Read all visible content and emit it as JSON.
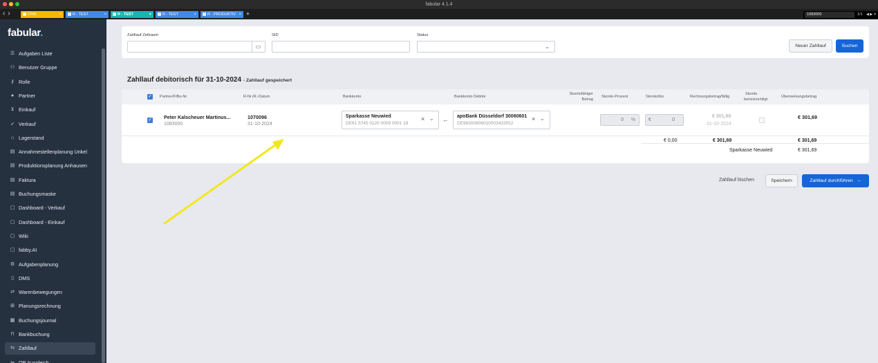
{
  "window": {
    "title": "fabular 4.1.4"
  },
  "tabs": [
    {
      "label": "CRM",
      "color": "#f5b800"
    },
    {
      "label": "R - TEST",
      "color": "#3e8be8"
    },
    {
      "label": "R - TEST",
      "color": "#17b6b0"
    },
    {
      "label": "R - TEST",
      "color": "#3e8be8"
    },
    {
      "label": "R - PRODUKTIV",
      "color": "#3e8be8"
    }
  ],
  "find": {
    "value": "1083000",
    "count": "1/1"
  },
  "sidebar": {
    "logo": "fabular",
    "items": [
      {
        "label": "Aufgaben Liste",
        "icon": "list-icon"
      },
      {
        "label": "Benutzer Gruppe",
        "icon": "group-icon"
      },
      {
        "label": "Rolle",
        "icon": "key-icon"
      },
      {
        "label": "Partner",
        "icon": "person-icon"
      },
      {
        "label": "Einkauf",
        "icon": "cart-icon"
      },
      {
        "label": "Verkauf",
        "icon": "rocket-icon"
      },
      {
        "label": "Lagerstand",
        "icon": "warehouse-icon"
      },
      {
        "label": "Annahmestellenplanung Unkel",
        "icon": "document-icon"
      },
      {
        "label": "Produktionsplanung Anhausen",
        "icon": "document-icon"
      },
      {
        "label": "Faktura",
        "icon": "document-icon"
      },
      {
        "label": "Buchungsmaske",
        "icon": "document-icon"
      },
      {
        "label": "Dashboard - Verkauf",
        "icon": "chat-icon"
      },
      {
        "label": "Dashboard - Einkauf",
        "icon": "chat-icon"
      },
      {
        "label": "Wiki",
        "icon": "chat-icon"
      },
      {
        "label": "fabby.AI",
        "icon": "chat-icon"
      },
      {
        "label": "Aufgabenplanung",
        "icon": "gear-icon"
      },
      {
        "label": "DMS",
        "icon": "folder-icon"
      },
      {
        "label": "Warenbewegungen",
        "icon": "movement-icon"
      },
      {
        "label": "Planungsrechnung",
        "icon": "calc-icon"
      },
      {
        "label": "Buchungsjournal",
        "icon": "journal-icon"
      },
      {
        "label": "Bankbuchung",
        "icon": "bank-icon"
      },
      {
        "label": "Zahllauf",
        "icon": "payment-icon",
        "active": true
      },
      {
        "label": "OP Ausgleich",
        "icon": "balance-icon"
      }
    ]
  },
  "filter": {
    "zeitraum_label": "Zahllauf Zeitraum",
    "zeitraum_value": "",
    "sid_label": "SID",
    "sid_value": "",
    "status_label": "Status",
    "status_value": "",
    "new_button": "Neuer Zahllauf",
    "search_button": "Suchen"
  },
  "section": {
    "title": "Zahllauf debitorisch für 31-10-2024",
    "subtitle": "- Zahllauf gespeichert"
  },
  "table": {
    "headers": {
      "partner": "Partner/FiBu-Nr.",
      "rnr": "R-Nr./R.-Datum",
      "bankkonto": "Bankkonto",
      "bankkonto_debitor": "Bankkonto Debitor",
      "skontofaehig_1": "Skontofähiger",
      "skontofaehig_2": "Betrag",
      "skonto_prozent": "Skonto-Prozent",
      "skonto_bis": "Skonto/bis",
      "rechnungsbetrag": "Rechnungsbetrag/fällig",
      "skonto_ber_1": "Skonto",
      "skonto_ber_2": "berücksichtigt",
      "ueberweisung": "Überweisungsbetrag"
    },
    "row": {
      "partner_name": "Peter Kalscheuer Martinus...",
      "partner_nr": "1083000",
      "rnr": "1070096",
      "rdatum": "31-10-2024",
      "bank_name": "Sparkasse Neuwied",
      "bank_iban": "DE61 5745 0120 0009 0001 18",
      "debitor_bank": "apoBank Düsseldorf 30060601",
      "debitor_iban": "DE98300606010003433552",
      "skonto_prozent": "0",
      "skonto_prozent_unit": "%",
      "skonto_currency": "€",
      "skonto_betrag": "0",
      "rechnungsbetrag": "€ 301,69",
      "faellig": "31-10-2024",
      "ueberweisung": "€ 301,69"
    },
    "totals": {
      "skonto_sum": "€ 0,00",
      "rechnung_sum": "€ 301,69",
      "ueberweisung_sum": "€ 301,69",
      "bank_label": "Sparkasse Neuwied",
      "bank_sum": "€ 301,69"
    }
  },
  "actions": {
    "delete": "Zahllauf löschen",
    "save": "Speichern",
    "execute": "Zahllauf durchführen"
  },
  "colors": {
    "primary": "#1565d8",
    "sidebar_bg": "#263140",
    "arrow": "#f2e71c"
  }
}
